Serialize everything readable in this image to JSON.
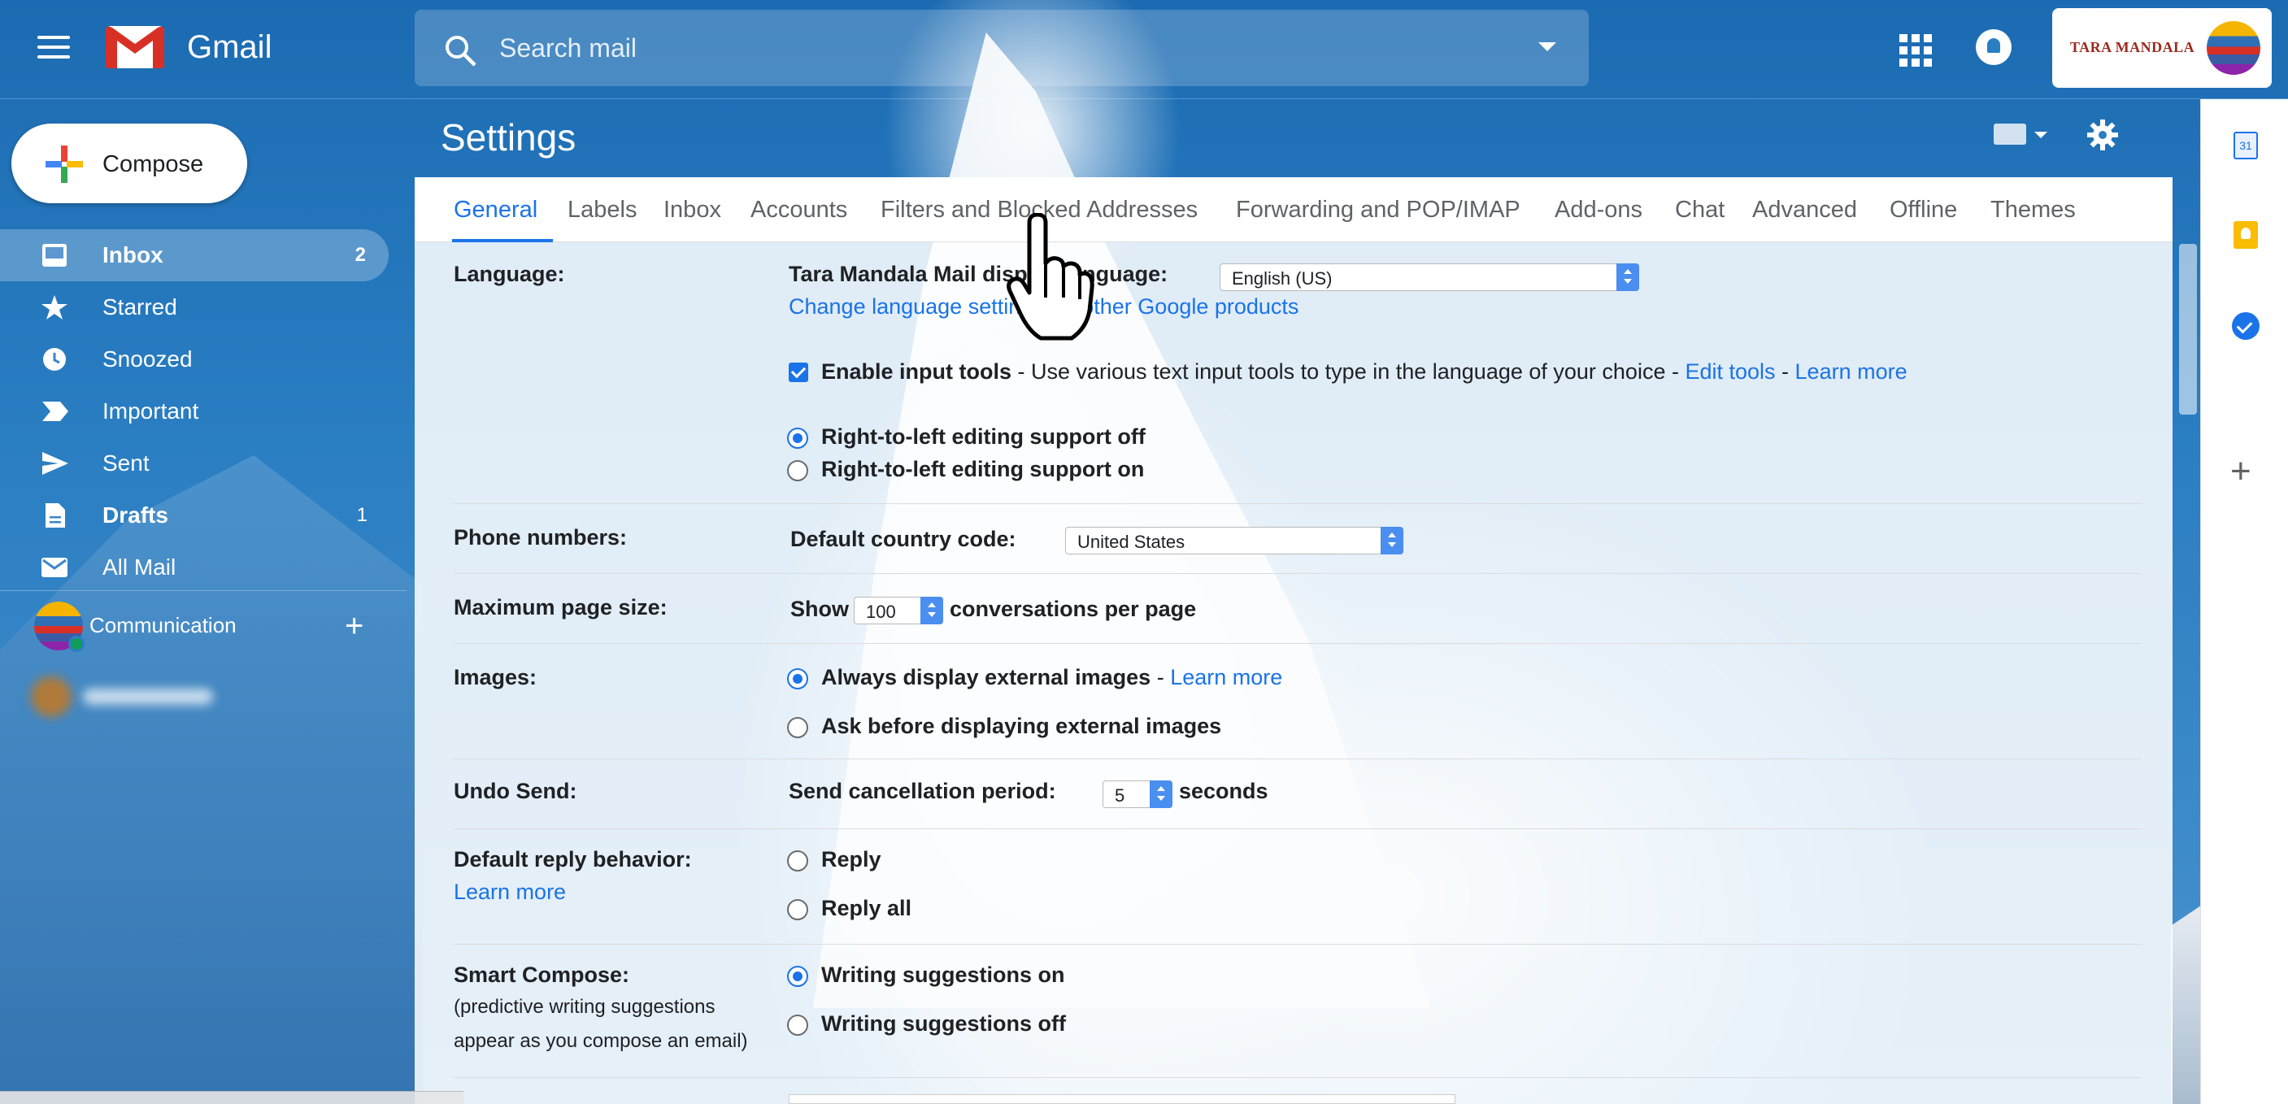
{
  "app": {
    "name": "Gmail"
  },
  "search": {
    "placeholder": "Search mail"
  },
  "account": {
    "org_logo_text": "TARA MANDALA"
  },
  "compose": {
    "label": "Compose"
  },
  "sidebar": {
    "items": [
      {
        "label": "Inbox",
        "count": "2",
        "icon": "inbox-icon"
      },
      {
        "label": "Starred",
        "count": "",
        "icon": "star-icon"
      },
      {
        "label": "Snoozed",
        "count": "",
        "icon": "clock-icon"
      },
      {
        "label": "Important",
        "count": "",
        "icon": "important-icon"
      },
      {
        "label": "Sent",
        "count": "",
        "icon": "send-icon"
      },
      {
        "label": "Drafts",
        "count": "1",
        "icon": "draft-icon"
      },
      {
        "label": "All Mail",
        "count": "",
        "icon": "mail-icon"
      }
    ],
    "hangouts": {
      "name": "Communication",
      "plus": "+"
    }
  },
  "page": {
    "title": "Settings"
  },
  "tabs": [
    "General",
    "Labels",
    "Inbox",
    "Accounts",
    "Filters and Blocked Addresses",
    "Forwarding and POP/IMAP",
    "Add-ons",
    "Chat",
    "Advanced",
    "Offline",
    "Themes"
  ],
  "settings": {
    "language": {
      "label": "Language:",
      "prompt": "Tara Mandala Mail display language:",
      "value": "English (US)",
      "change_link": "Change language settings for other Google products",
      "input_tools_label": "Enable input tools",
      "input_tools_desc": " - Use various text input tools to type in the language of your choice - ",
      "edit_tools": "Edit tools",
      "dash": " - ",
      "learn_more": "Learn more",
      "rtl_off": "Right-to-left editing support off",
      "rtl_on": "Right-to-left editing support on"
    },
    "phone": {
      "label": "Phone numbers:",
      "prompt": "Default country code:",
      "value": "United States"
    },
    "page_size": {
      "label": "Maximum page size:",
      "show": "Show",
      "value": "100",
      "suffix": "conversations per page"
    },
    "images": {
      "label": "Images:",
      "always": "Always display external images",
      "dash": " - ",
      "learn_more": "Learn more",
      "ask": "Ask before displaying external images"
    },
    "undo": {
      "label": "Undo Send:",
      "prompt": "Send cancellation period:",
      "value": "5",
      "suffix": "seconds"
    },
    "reply": {
      "label": "Default reply behavior:",
      "learn_more": "Learn more",
      "reply": "Reply",
      "reply_all": "Reply all"
    },
    "smart_compose": {
      "label": "Smart Compose:",
      "desc_1": "(predictive writing suggestions",
      "desc_2": "appear as you compose an email)",
      "on": "Writing suggestions on",
      "off": "Writing suggestions off"
    }
  },
  "colors": {
    "accent": "#1a73e8",
    "topbar_bg": "#2a7ec2"
  }
}
